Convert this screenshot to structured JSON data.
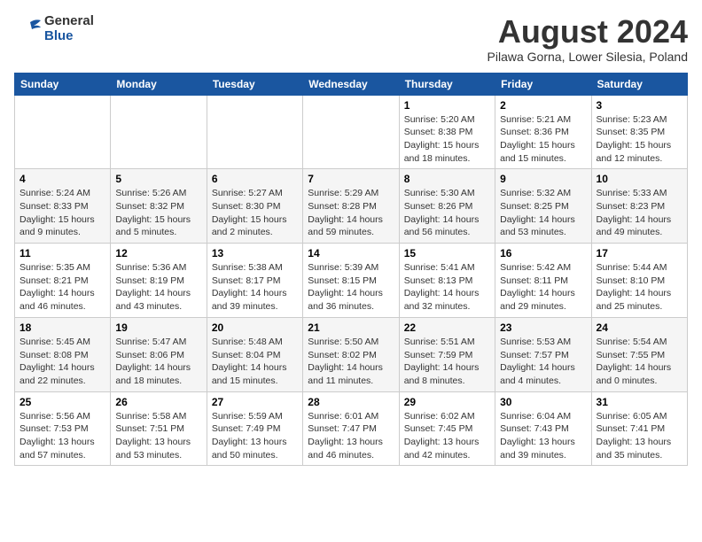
{
  "header": {
    "logo_general": "General",
    "logo_blue": "Blue",
    "month_title": "August 2024",
    "subtitle": "Pilawa Gorna, Lower Silesia, Poland"
  },
  "days_of_week": [
    "Sunday",
    "Monday",
    "Tuesday",
    "Wednesday",
    "Thursday",
    "Friday",
    "Saturday"
  ],
  "weeks": [
    [
      {
        "day": "",
        "content": ""
      },
      {
        "day": "",
        "content": ""
      },
      {
        "day": "",
        "content": ""
      },
      {
        "day": "",
        "content": ""
      },
      {
        "day": "1",
        "content": "Sunrise: 5:20 AM\nSunset: 8:38 PM\nDaylight: 15 hours\nand 18 minutes."
      },
      {
        "day": "2",
        "content": "Sunrise: 5:21 AM\nSunset: 8:36 PM\nDaylight: 15 hours\nand 15 minutes."
      },
      {
        "day": "3",
        "content": "Sunrise: 5:23 AM\nSunset: 8:35 PM\nDaylight: 15 hours\nand 12 minutes."
      }
    ],
    [
      {
        "day": "4",
        "content": "Sunrise: 5:24 AM\nSunset: 8:33 PM\nDaylight: 15 hours\nand 9 minutes."
      },
      {
        "day": "5",
        "content": "Sunrise: 5:26 AM\nSunset: 8:32 PM\nDaylight: 15 hours\nand 5 minutes."
      },
      {
        "day": "6",
        "content": "Sunrise: 5:27 AM\nSunset: 8:30 PM\nDaylight: 15 hours\nand 2 minutes."
      },
      {
        "day": "7",
        "content": "Sunrise: 5:29 AM\nSunset: 8:28 PM\nDaylight: 14 hours\nand 59 minutes."
      },
      {
        "day": "8",
        "content": "Sunrise: 5:30 AM\nSunset: 8:26 PM\nDaylight: 14 hours\nand 56 minutes."
      },
      {
        "day": "9",
        "content": "Sunrise: 5:32 AM\nSunset: 8:25 PM\nDaylight: 14 hours\nand 53 minutes."
      },
      {
        "day": "10",
        "content": "Sunrise: 5:33 AM\nSunset: 8:23 PM\nDaylight: 14 hours\nand 49 minutes."
      }
    ],
    [
      {
        "day": "11",
        "content": "Sunrise: 5:35 AM\nSunset: 8:21 PM\nDaylight: 14 hours\nand 46 minutes."
      },
      {
        "day": "12",
        "content": "Sunrise: 5:36 AM\nSunset: 8:19 PM\nDaylight: 14 hours\nand 43 minutes."
      },
      {
        "day": "13",
        "content": "Sunrise: 5:38 AM\nSunset: 8:17 PM\nDaylight: 14 hours\nand 39 minutes."
      },
      {
        "day": "14",
        "content": "Sunrise: 5:39 AM\nSunset: 8:15 PM\nDaylight: 14 hours\nand 36 minutes."
      },
      {
        "day": "15",
        "content": "Sunrise: 5:41 AM\nSunset: 8:13 PM\nDaylight: 14 hours\nand 32 minutes."
      },
      {
        "day": "16",
        "content": "Sunrise: 5:42 AM\nSunset: 8:11 PM\nDaylight: 14 hours\nand 29 minutes."
      },
      {
        "day": "17",
        "content": "Sunrise: 5:44 AM\nSunset: 8:10 PM\nDaylight: 14 hours\nand 25 minutes."
      }
    ],
    [
      {
        "day": "18",
        "content": "Sunrise: 5:45 AM\nSunset: 8:08 PM\nDaylight: 14 hours\nand 22 minutes."
      },
      {
        "day": "19",
        "content": "Sunrise: 5:47 AM\nSunset: 8:06 PM\nDaylight: 14 hours\nand 18 minutes."
      },
      {
        "day": "20",
        "content": "Sunrise: 5:48 AM\nSunset: 8:04 PM\nDaylight: 14 hours\nand 15 minutes."
      },
      {
        "day": "21",
        "content": "Sunrise: 5:50 AM\nSunset: 8:02 PM\nDaylight: 14 hours\nand 11 minutes."
      },
      {
        "day": "22",
        "content": "Sunrise: 5:51 AM\nSunset: 7:59 PM\nDaylight: 14 hours\nand 8 minutes."
      },
      {
        "day": "23",
        "content": "Sunrise: 5:53 AM\nSunset: 7:57 PM\nDaylight: 14 hours\nand 4 minutes."
      },
      {
        "day": "24",
        "content": "Sunrise: 5:54 AM\nSunset: 7:55 PM\nDaylight: 14 hours\nand 0 minutes."
      }
    ],
    [
      {
        "day": "25",
        "content": "Sunrise: 5:56 AM\nSunset: 7:53 PM\nDaylight: 13 hours\nand 57 minutes."
      },
      {
        "day": "26",
        "content": "Sunrise: 5:58 AM\nSunset: 7:51 PM\nDaylight: 13 hours\nand 53 minutes."
      },
      {
        "day": "27",
        "content": "Sunrise: 5:59 AM\nSunset: 7:49 PM\nDaylight: 13 hours\nand 50 minutes."
      },
      {
        "day": "28",
        "content": "Sunrise: 6:01 AM\nSunset: 7:47 PM\nDaylight: 13 hours\nand 46 minutes."
      },
      {
        "day": "29",
        "content": "Sunrise: 6:02 AM\nSunset: 7:45 PM\nDaylight: 13 hours\nand 42 minutes."
      },
      {
        "day": "30",
        "content": "Sunrise: 6:04 AM\nSunset: 7:43 PM\nDaylight: 13 hours\nand 39 minutes."
      },
      {
        "day": "31",
        "content": "Sunrise: 6:05 AM\nSunset: 7:41 PM\nDaylight: 13 hours\nand 35 minutes."
      }
    ]
  ]
}
